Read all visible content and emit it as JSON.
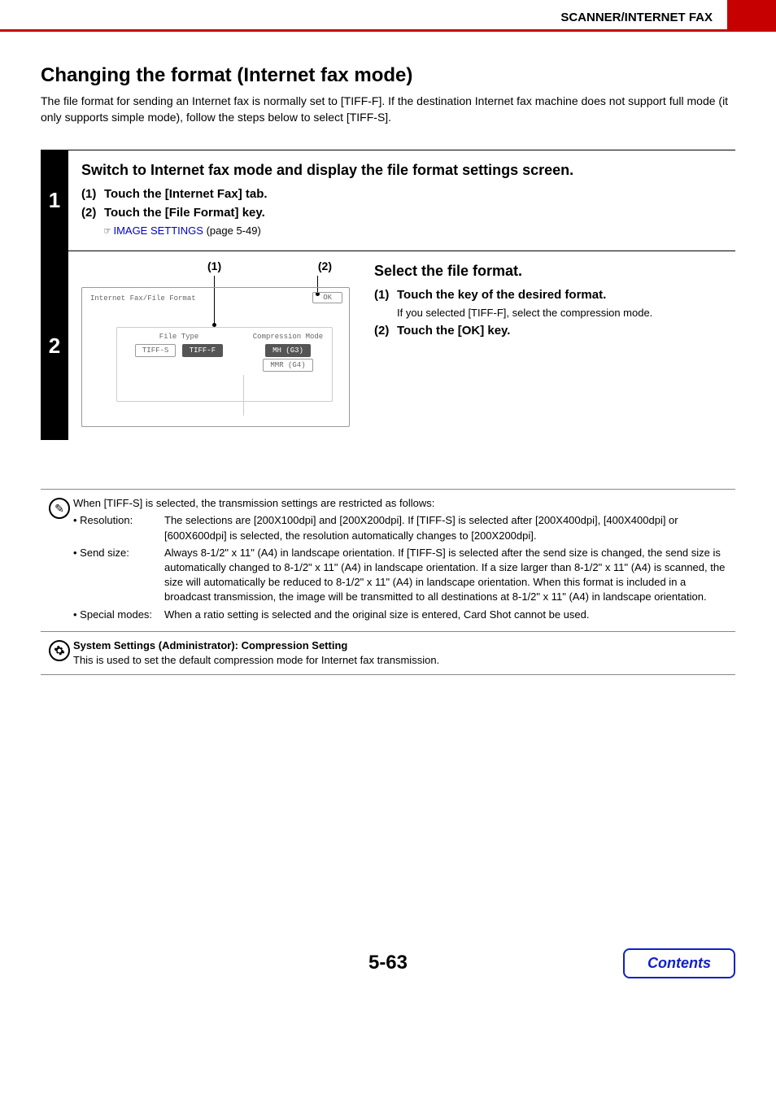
{
  "header": {
    "section": "SCANNER/INTERNET FAX"
  },
  "title": "Changing the format (Internet fax mode)",
  "intro": "The file format for sending an Internet fax is normally set to [TIFF-F]. If the destination Internet fax machine does not support full mode (it only supports simple mode), follow the steps below to select [TIFF-S].",
  "steps": {
    "s1": {
      "num": "1",
      "heading": "Switch to Internet fax mode and display the file format settings screen.",
      "sub1_num": "(1)",
      "sub1": "Touch the [Internet Fax] tab.",
      "sub2_num": "(2)",
      "sub2": "Touch the [File Format] key.",
      "pointer": "☞",
      "link": "IMAGE SETTINGS",
      "link_page": " (page 5-49)"
    },
    "s2": {
      "num": "2",
      "callout1": "(1)",
      "callout2": "(2)",
      "panel_title": "Internet Fax/File Format",
      "ok": "OK",
      "filetype_label": "File Type",
      "tiff_s": "TIFF-S",
      "tiff_f": "TIFF-F",
      "comp_label": "Compression Mode",
      "mh": "MH (G3)",
      "mmr": "MMR (G4)",
      "heading": "Select the file format.",
      "sub1_num": "(1)",
      "sub1": "Touch the key of the desired format.",
      "sub1_note": "If you selected [TIFF-F], select the compression mode.",
      "sub2_num": "(2)",
      "sub2": "Touch the [OK] key."
    }
  },
  "notes": {
    "intro": "When [TIFF-S] is selected, the transmission settings are restricted as follows:",
    "r1_label": "• Resolution:",
    "r1_val": "The selections are [200X100dpi] and [200X200dpi]. If [TIFF-S] is selected after [200X400dpi], [400X400dpi] or [600X600dpi] is selected, the resolution automatically changes to [200X200dpi].",
    "r2_label": "• Send size:",
    "r2_val": "Always 8-1/2\" x 11\" (A4) in landscape orientation. If [TIFF-S] is selected after the send size is changed, the send size is automatically changed to 8-1/2\" x 11\" (A4) in landscape orientation. If a size larger than 8-1/2\" x 11\" (A4) is scanned, the size will automatically be reduced to 8-1/2\" x 11\" (A4) in landscape orientation. When this format is included in a broadcast transmission, the image will be transmitted to all destinations at 8-1/2\" x 11\" (A4) in landscape orientation.",
    "r3_label": "• Special modes:",
    "r3_val": "When a ratio setting is selected and the original size is entered, Card Shot cannot be used.",
    "admin_title": "System Settings (Administrator): Compression Setting",
    "admin_body": "This is used to set the default compression mode for Internet fax transmission."
  },
  "footer": {
    "page": "5-63",
    "contents": "Contents"
  }
}
